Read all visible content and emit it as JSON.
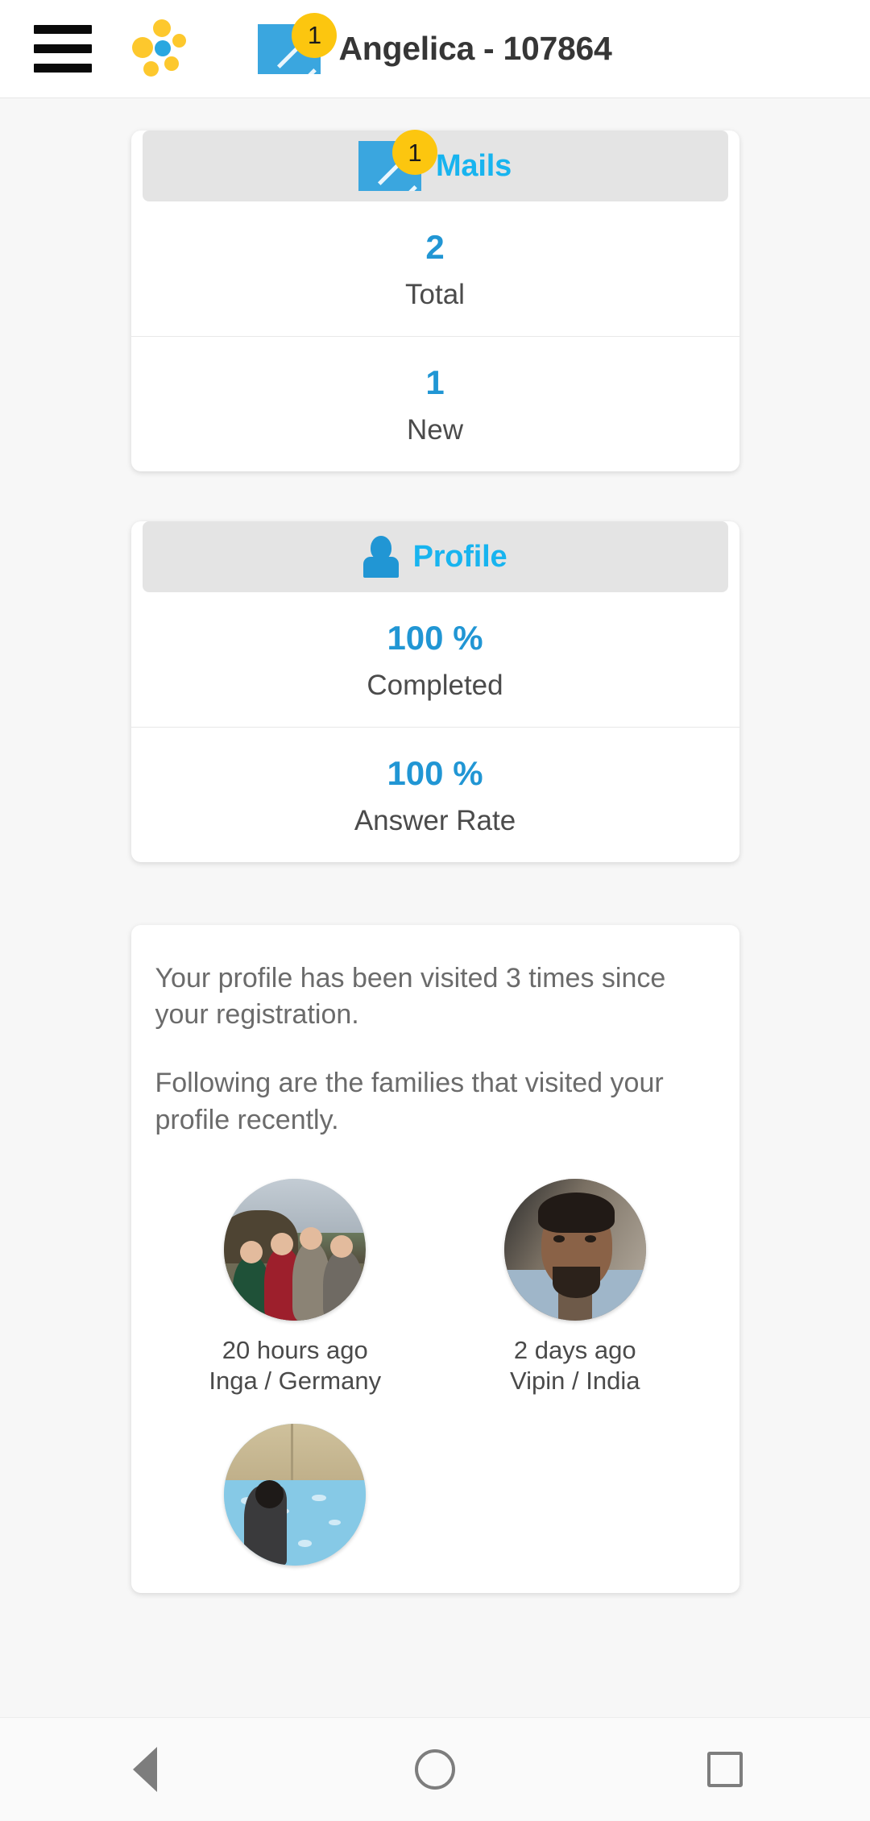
{
  "appbar": {
    "menu_icon": "hamburger-menu-icon",
    "logo_icon": "app-logo-flower-icon",
    "mail_icon": "envelope-icon",
    "mail_badge": "1",
    "title": "Angelica - 107864"
  },
  "colors": {
    "accent_cyan": "#18b4ef",
    "accent_blue": "#2196d4",
    "badge_yellow": "#fcc60f",
    "logo_yellow": "#fdc82d",
    "logo_blue": "#29a7e0",
    "page_bg": "#f7f7f7",
    "card_head_bg": "#e4e4e4",
    "text_gray": "#6b6b6b"
  },
  "cards": {
    "mails": {
      "icon": "envelope-icon",
      "badge": "1",
      "title": "Mails",
      "stats": [
        {
          "value": "2",
          "label": "Total"
        },
        {
          "value": "1",
          "label": "New"
        }
      ]
    },
    "profile": {
      "icon": "person-icon",
      "title": "Profile",
      "stats": [
        {
          "value": "100 %",
          "label": "Completed"
        },
        {
          "value": "100 %",
          "label": "Answer Rate"
        }
      ]
    },
    "visitors": {
      "paragraph1": "Your profile has been visited 3 times since your registration.",
      "paragraph2": "Following are the families that visited your profile recently.",
      "items": [
        {
          "time": "20 hours ago",
          "who": "Inga / Germany",
          "avatar": "family-photo-avatar"
        },
        {
          "time": "2 days ago",
          "who": "Vipin / India",
          "avatar": "man-photo-avatar"
        },
        {
          "time": "",
          "who": "",
          "avatar": "pool-photo-avatar"
        }
      ]
    }
  },
  "navbar": {
    "back": "back-icon",
    "home": "home-icon",
    "recents": "recents-icon"
  }
}
